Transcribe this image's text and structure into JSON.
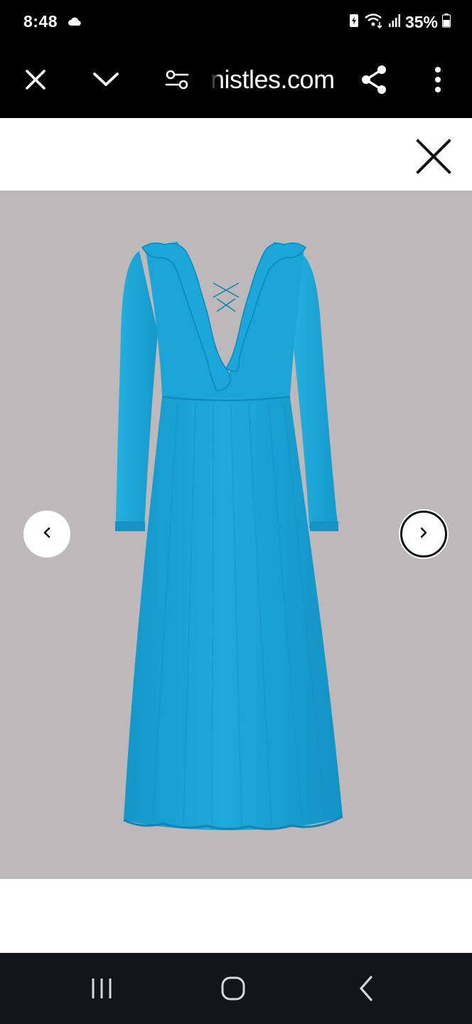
{
  "status_bar": {
    "time": "8:48",
    "battery_percent": "35%",
    "icons": [
      "cloud-icon",
      "battery-saver-icon",
      "wifi-icon",
      "signal-icon",
      "battery-icon"
    ]
  },
  "browser": {
    "url_text": "nistles.com",
    "icons": [
      "close-icon",
      "chevron-down-icon",
      "site-settings-icon",
      "share-icon",
      "more-vert-icon"
    ]
  },
  "gallery": {
    "background_color": "#bdb8b9",
    "product_color": "#1aa6d6",
    "close_icon": "close-icon",
    "prev_icon": "chevron-left-icon",
    "next_icon": "chevron-right-icon"
  },
  "system_nav": {
    "icons": [
      "recent-apps-icon",
      "home-icon",
      "back-icon"
    ]
  }
}
